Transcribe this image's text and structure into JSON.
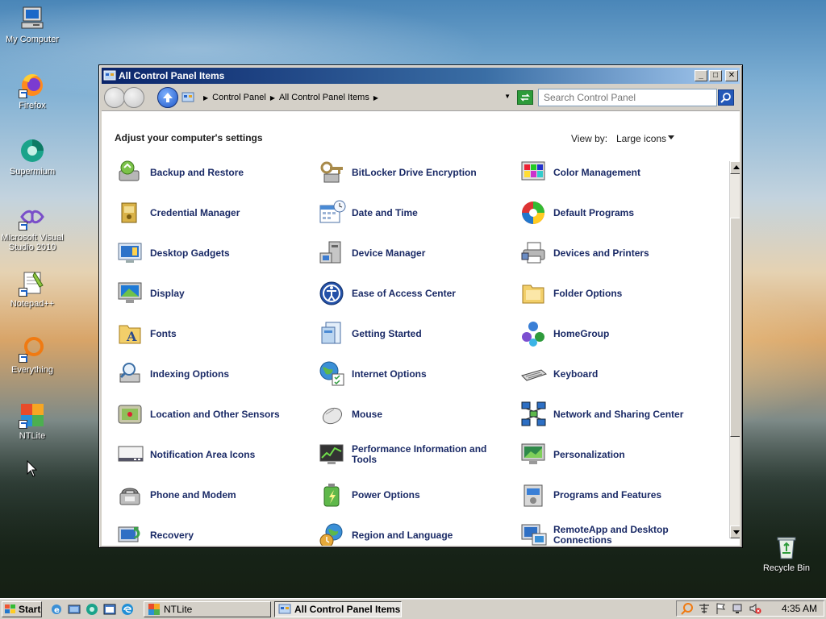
{
  "desktop": {
    "icons": [
      {
        "label": "My Computer"
      },
      {
        "label": "Firefox"
      },
      {
        "label": "Supermium"
      },
      {
        "label": "Microsoft Visual Studio 2010"
      },
      {
        "label": "Notepad++"
      },
      {
        "label": "Everything"
      },
      {
        "label": "NTLite"
      },
      {
        "label": "Recycle Bin"
      }
    ]
  },
  "window": {
    "title": "All Control Panel Items",
    "breadcrumb": [
      "Control Panel",
      "All Control Panel Items"
    ],
    "search_placeholder": "Search Control Panel",
    "heading": "Adjust your computer's settings",
    "view_by_label": "View by:",
    "view_by_value": "Large icons",
    "items": [
      {
        "label": "Backup and Restore",
        "icon": "backup-icon"
      },
      {
        "label": "BitLocker Drive Encryption",
        "icon": "bitlocker-icon"
      },
      {
        "label": "Color Management",
        "icon": "color-management-icon"
      },
      {
        "label": "Credential Manager",
        "icon": "credential-icon"
      },
      {
        "label": "Date and Time",
        "icon": "calendar-clock-icon"
      },
      {
        "label": "Default Programs",
        "icon": "default-programs-icon"
      },
      {
        "label": "Desktop Gadgets",
        "icon": "gadgets-icon"
      },
      {
        "label": "Device Manager",
        "icon": "device-manager-icon"
      },
      {
        "label": "Devices and Printers",
        "icon": "printer-icon"
      },
      {
        "label": "Display",
        "icon": "monitor-icon"
      },
      {
        "label": "Ease of Access Center",
        "icon": "ease-of-access-icon"
      },
      {
        "label": "Folder Options",
        "icon": "folder-icon"
      },
      {
        "label": "Fonts",
        "icon": "fonts-folder-icon"
      },
      {
        "label": "Getting Started",
        "icon": "getting-started-icon"
      },
      {
        "label": "HomeGroup",
        "icon": "homegroup-icon"
      },
      {
        "label": "Indexing Options",
        "icon": "indexing-icon"
      },
      {
        "label": "Internet Options",
        "icon": "internet-globe-icon"
      },
      {
        "label": "Keyboard",
        "icon": "keyboard-icon"
      },
      {
        "label": "Location and Other Sensors",
        "icon": "sensor-icon"
      },
      {
        "label": "Mouse",
        "icon": "mouse-icon"
      },
      {
        "label": "Network and Sharing Center",
        "icon": "network-icon"
      },
      {
        "label": "Notification Area Icons",
        "icon": "notification-icon"
      },
      {
        "label": "Performance Information and Tools",
        "icon": "performance-icon"
      },
      {
        "label": "Personalization",
        "icon": "personalization-icon"
      },
      {
        "label": "Phone and Modem",
        "icon": "phone-icon"
      },
      {
        "label": "Power Options",
        "icon": "battery-icon"
      },
      {
        "label": "Programs and Features",
        "icon": "programs-icon"
      },
      {
        "label": "Recovery",
        "icon": "recovery-icon"
      },
      {
        "label": "Region and Language",
        "icon": "region-globe-icon"
      },
      {
        "label": "RemoteApp and Desktop Connections",
        "icon": "remoteapp-icon"
      }
    ]
  },
  "taskbar": {
    "start_label": "Start",
    "tasks": [
      {
        "label": "NTLite"
      },
      {
        "label": "All Control Panel Items"
      }
    ],
    "clock": "4:35 AM"
  }
}
